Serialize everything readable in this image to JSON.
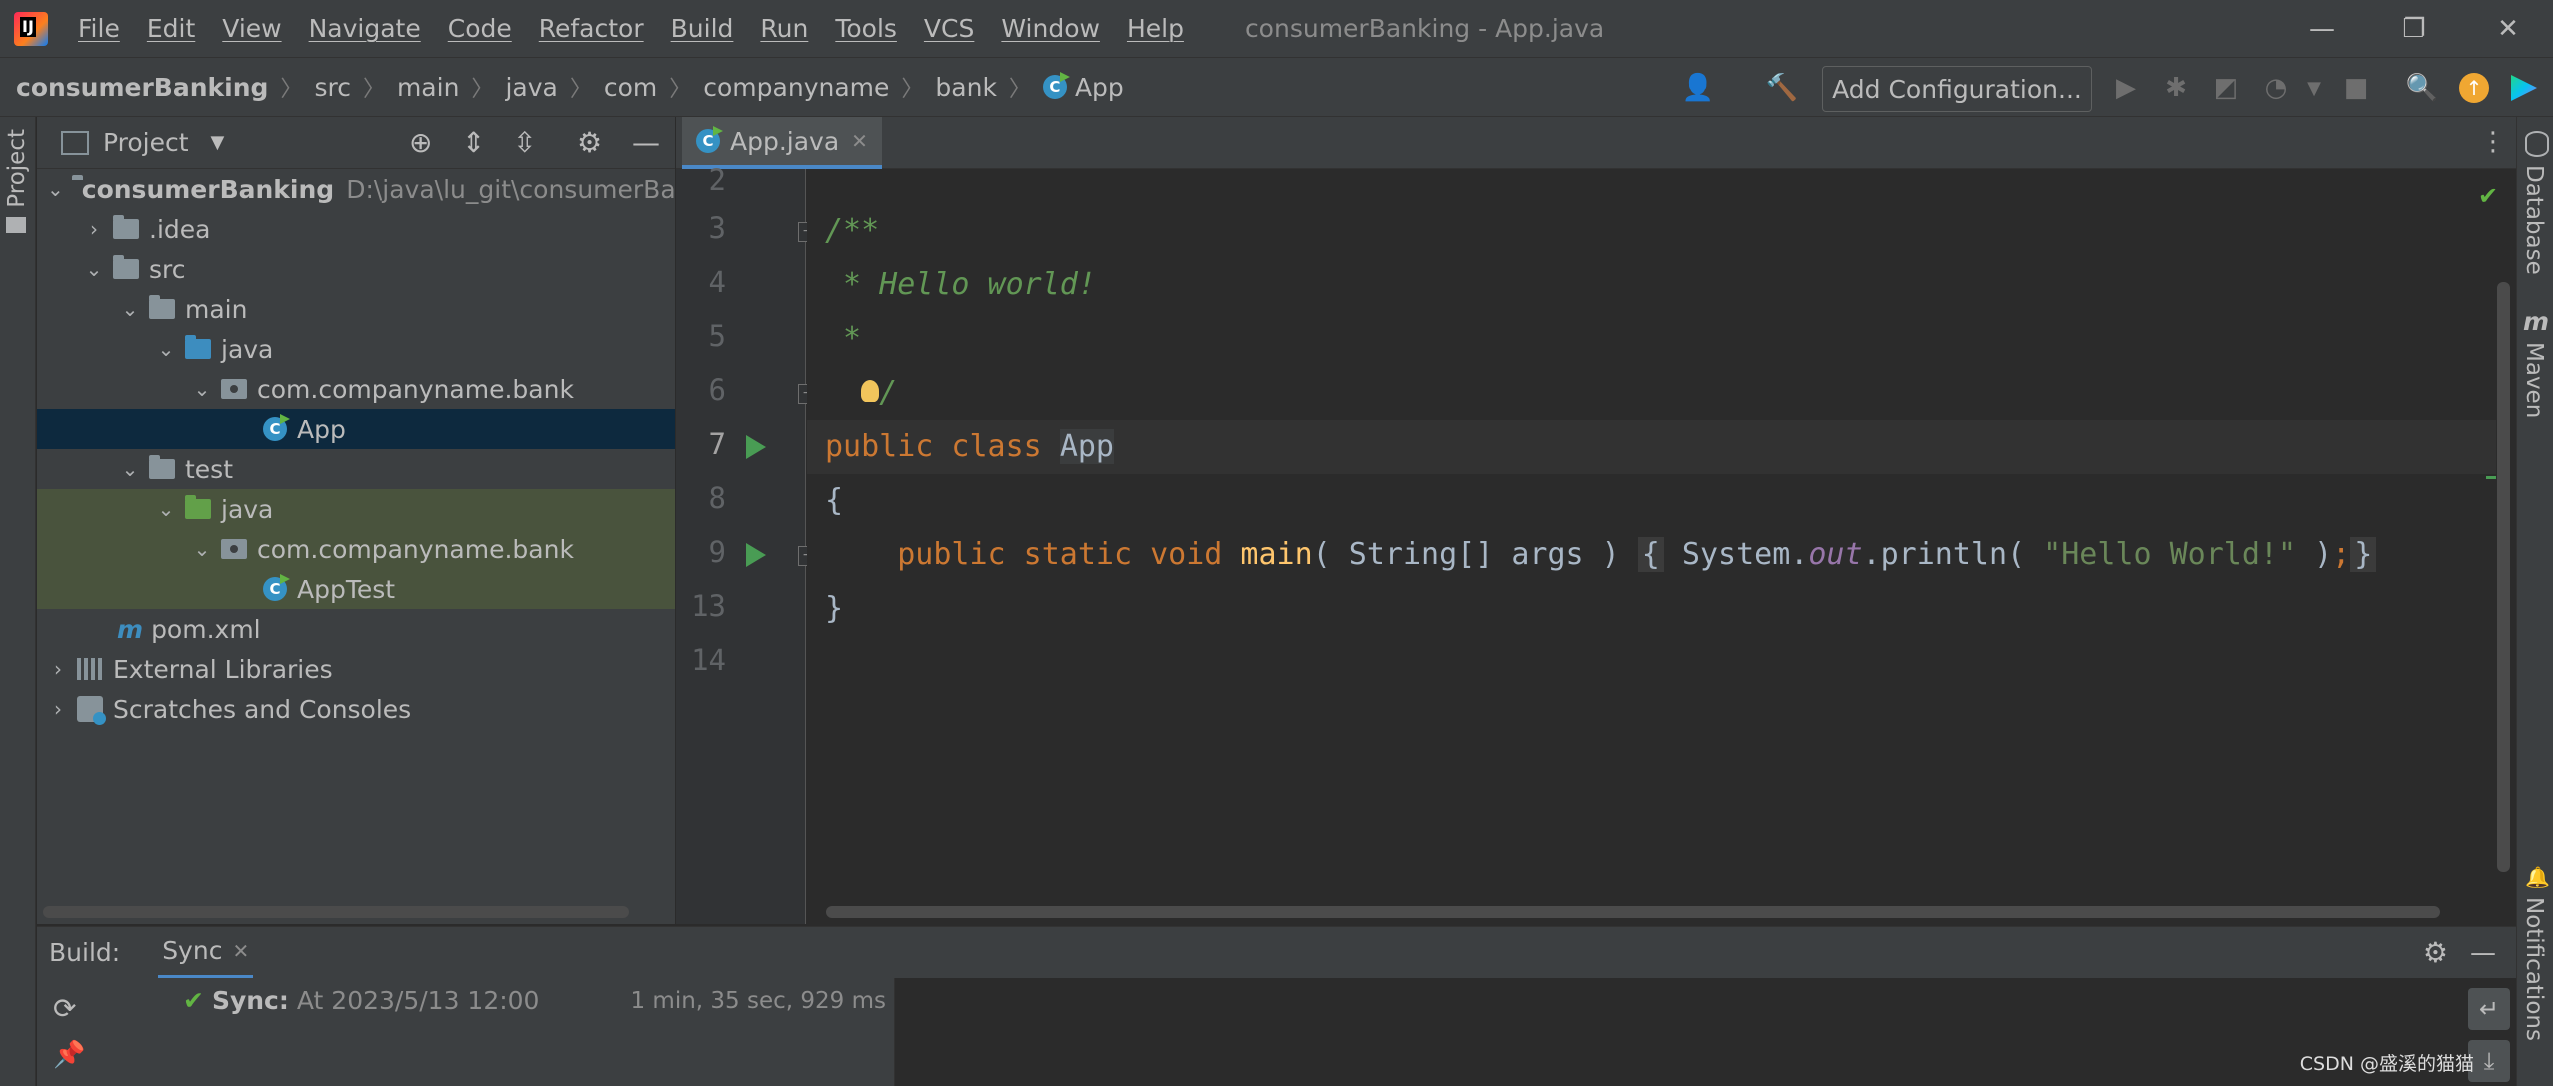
{
  "menubar": {
    "items": [
      "File",
      "Edit",
      "View",
      "Navigate",
      "Code",
      "Refactor",
      "Build",
      "Run",
      "Tools",
      "VCS",
      "Window",
      "Help"
    ],
    "title": "consumerBanking - App.java",
    "controls": {
      "minimize": "—",
      "restore": "❐",
      "close": "✕"
    }
  },
  "navbar": {
    "breadcrumbs": [
      "consumerBanking",
      "src",
      "main",
      "java",
      "com",
      "companyname",
      "bank",
      "App"
    ],
    "separator": "〉",
    "add_configuration": "Add Configuration..."
  },
  "left_stripe": {
    "project_label": "Project"
  },
  "project_panel": {
    "title": "Project",
    "tree": [
      {
        "label": "consumerBanking",
        "extra": "D:\\java\\lu_git\\consumerBank"
      },
      {
        "label": ".idea"
      },
      {
        "label": "src"
      },
      {
        "label": "main"
      },
      {
        "label": "java"
      },
      {
        "label": "com.companyname.bank"
      },
      {
        "label": "App"
      },
      {
        "label": "test"
      },
      {
        "label": "java"
      },
      {
        "label": "com.companyname.bank"
      },
      {
        "label": "AppTest"
      },
      {
        "label": "pom.xml"
      },
      {
        "label": "External Libraries"
      },
      {
        "label": "Scratches and Consoles"
      }
    ]
  },
  "editor": {
    "tab_label": "App.java",
    "line_numbers": [
      "2",
      "3",
      "4",
      "5",
      "6",
      "7",
      "8",
      "9",
      "13",
      "14"
    ],
    "code": {
      "l3": "/**",
      "l4": " * Hello world!",
      "l5": " *",
      "l6": "/",
      "l7_kw": "public class ",
      "l7_name": "App",
      "l8": "{",
      "l9_kw": "public static void ",
      "l9_fn": "main",
      "l9_args": "( String[] args )",
      "l9_open": "{",
      "l9_sys": " System.",
      "l9_out": "out",
      "l9_println": ".println( ",
      "l9_str": "\"Hello World!\"",
      "l9_close_paren": " )",
      "l9_semi": ";",
      "l9_close": "}",
      "l13": "}"
    }
  },
  "right_stripe": {
    "database": "Database",
    "maven": "Maven",
    "notifications": "Notifications"
  },
  "build_panel": {
    "label": "Build:",
    "tab": "Sync",
    "sync_title": "Sync:",
    "sync_time": "At 2023/5/13 12:00",
    "duration": "1 min, 35 sec, 929 ms"
  },
  "watermark": "CSDN @盛溪的猫猫"
}
